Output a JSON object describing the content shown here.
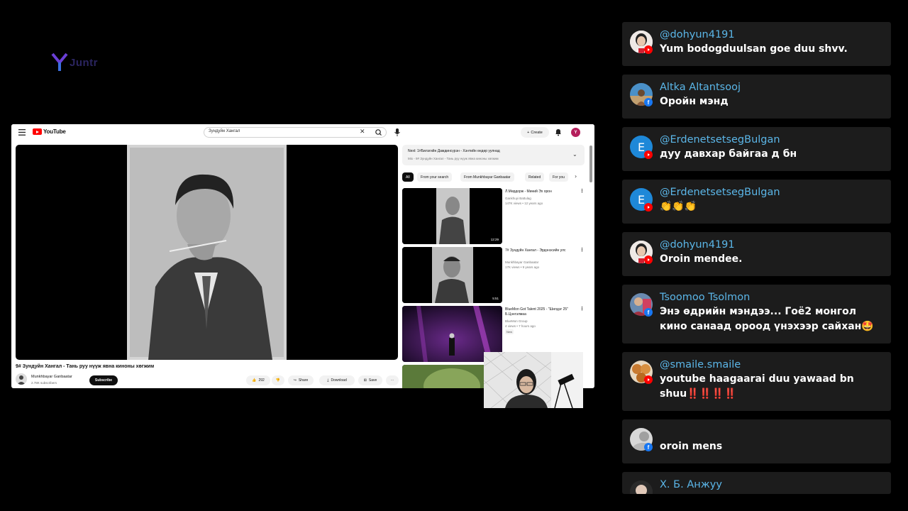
{
  "logo": {
    "text": "Juntr"
  },
  "youtube": {
    "logo_text": "YouTube",
    "search_value": "Зундуйн Хангал",
    "create_label": "Create",
    "avatar_letter": "Y",
    "video": {
      "title": "9# Зундуйн Хангал - Тань руу нүүж явна киноны хөгжим",
      "channel": "Munkhbayar Ganbaatar",
      "subscribers": "2.78K subscribers",
      "subscribe_label": "Subscribe",
      "likes": "292",
      "share_label": "Share",
      "download_label": "Download",
      "save_label": "Save"
    },
    "next": {
      "title": "Next: 1#Билэгийн Дамдинсүрэн - Хэнтийн өндөр уулнад",
      "subtitle": "Mix - 9# Зундуйн Хангал - Тань руу нүүж явна киноны хөгжим"
    },
    "chips": [
      "All",
      "From your search",
      "From Munkhbayar Ganbaatar",
      "Related",
      "For you"
    ],
    "recommendations": [
      {
        "title": "Л.Мөрдорж - Миний Эх орон",
        "channel": "Gankhuyi Battulag",
        "meta": "147K views • 12 years ago",
        "duration": "12:29"
      },
      {
        "title": "7# Зундуйн Хангал - Эрдэнэсийн улс",
        "channel": "Munkhbayar Ganbaatar",
        "meta": "17K views • 9 years ago",
        "duration": "5:51"
      },
      {
        "title": "BlueMon Got Talent 2025 - \"Шилдэг 25\" Б.Цэнгэлмаа",
        "channel": "BlueMon Group",
        "meta": "4 views • 7 hours ago",
        "badge": "New"
      }
    ]
  },
  "chat": [
    {
      "name": "@dohyun4191",
      "message": "Yum bodogduulsan goe duu shvv.",
      "platform": "youtube"
    },
    {
      "name": "Altka Altantsooj",
      "message": "Оройн мэнд",
      "platform": "facebook"
    },
    {
      "name": "@ErdenetsetsegBulgan",
      "message": "дуу давхар байгаа д бн",
      "platform": "youtube",
      "initial": "E"
    },
    {
      "name": "@ErdenetsetsegBulgan",
      "message": "👏👏👏",
      "platform": "youtube",
      "initial": "E"
    },
    {
      "name": "@dohyun4191",
      "message": "Oroin mendee.",
      "platform": "youtube"
    },
    {
      "name": "Tsoomoo Tsolmon",
      "message": "Энэ өдрийн мэндээ... Гоё2 монгол кино санаад ороод үнэхээр сайхан🤩",
      "platform": "facebook"
    },
    {
      "name": "@smaile.smaile",
      "message": "youtube haagaarai duu yawaad bn shuu‼️‼️‼️‼️",
      "platform": "youtube"
    },
    {
      "name": "",
      "message": "oroin mens",
      "platform": "facebook"
    },
    {
      "name": "Х. Б. Анжуу",
      "message": "",
      "platform": "facebook"
    }
  ],
  "colors": {
    "youtube_red": "#ff0000",
    "facebook_blue": "#1877f2",
    "chat_name": "#5bb6e8",
    "chat_card": "#1c1c1c"
  }
}
